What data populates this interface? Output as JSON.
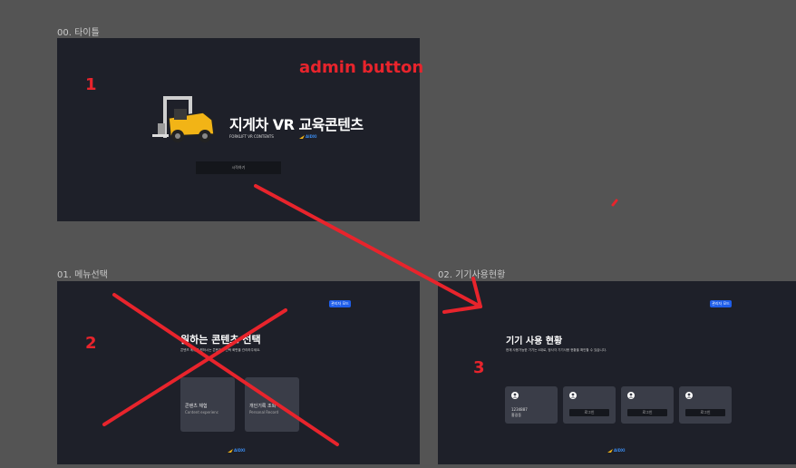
{
  "annotations": {
    "admin_note": "admin button",
    "num1": "1",
    "num2": "2",
    "num3": "3"
  },
  "frames": {
    "title": {
      "label": "00. 타이틀",
      "logo_title": "지게차 VR 교육콘텐츠",
      "logo_subtitle": "FORKLIFT VR CONTENTS",
      "brand": "AIDXI",
      "start_button": "시작하기"
    },
    "menu": {
      "label": "01. 메뉴선택",
      "admin_button": "관리자 모드",
      "heading": "원하는 콘텐츠 선택",
      "description": "콘텐츠 메뉴를 원하시는 콘텐츠를 선택 화면을 관리하주세요.",
      "cards": [
        {
          "title": "콘텐츠 체험",
          "subtitle": "Content experienc"
        },
        {
          "title": "개인기록 조회",
          "subtitle": "Personal Record"
        }
      ],
      "brand": "AIDXI"
    },
    "device": {
      "label": "02. 기기사용현황",
      "admin_button": "관리자 모드",
      "heading": "기기 사용 현황",
      "description": "현재 사용가능한 기기는 4대로, 정사각 기기사용 현황을 확인할 수 있습니다.",
      "cards": [
        {
          "line1": "1234887",
          "line2": "홍길동",
          "button": ""
        },
        {
          "line1": "",
          "line2": "",
          "button": "로그인"
        },
        {
          "line1": "",
          "line2": "",
          "button": "로그인"
        },
        {
          "line1": "",
          "line2": "",
          "button": "로그인"
        }
      ],
      "brand": "AIDXI"
    }
  },
  "colors": {
    "canvas_bg": "#545454",
    "frame_bg": "#1e2029",
    "annotation_red": "#e8242c",
    "accent_blue": "#1f5eea",
    "forklift_yellow": "#f2b416"
  }
}
